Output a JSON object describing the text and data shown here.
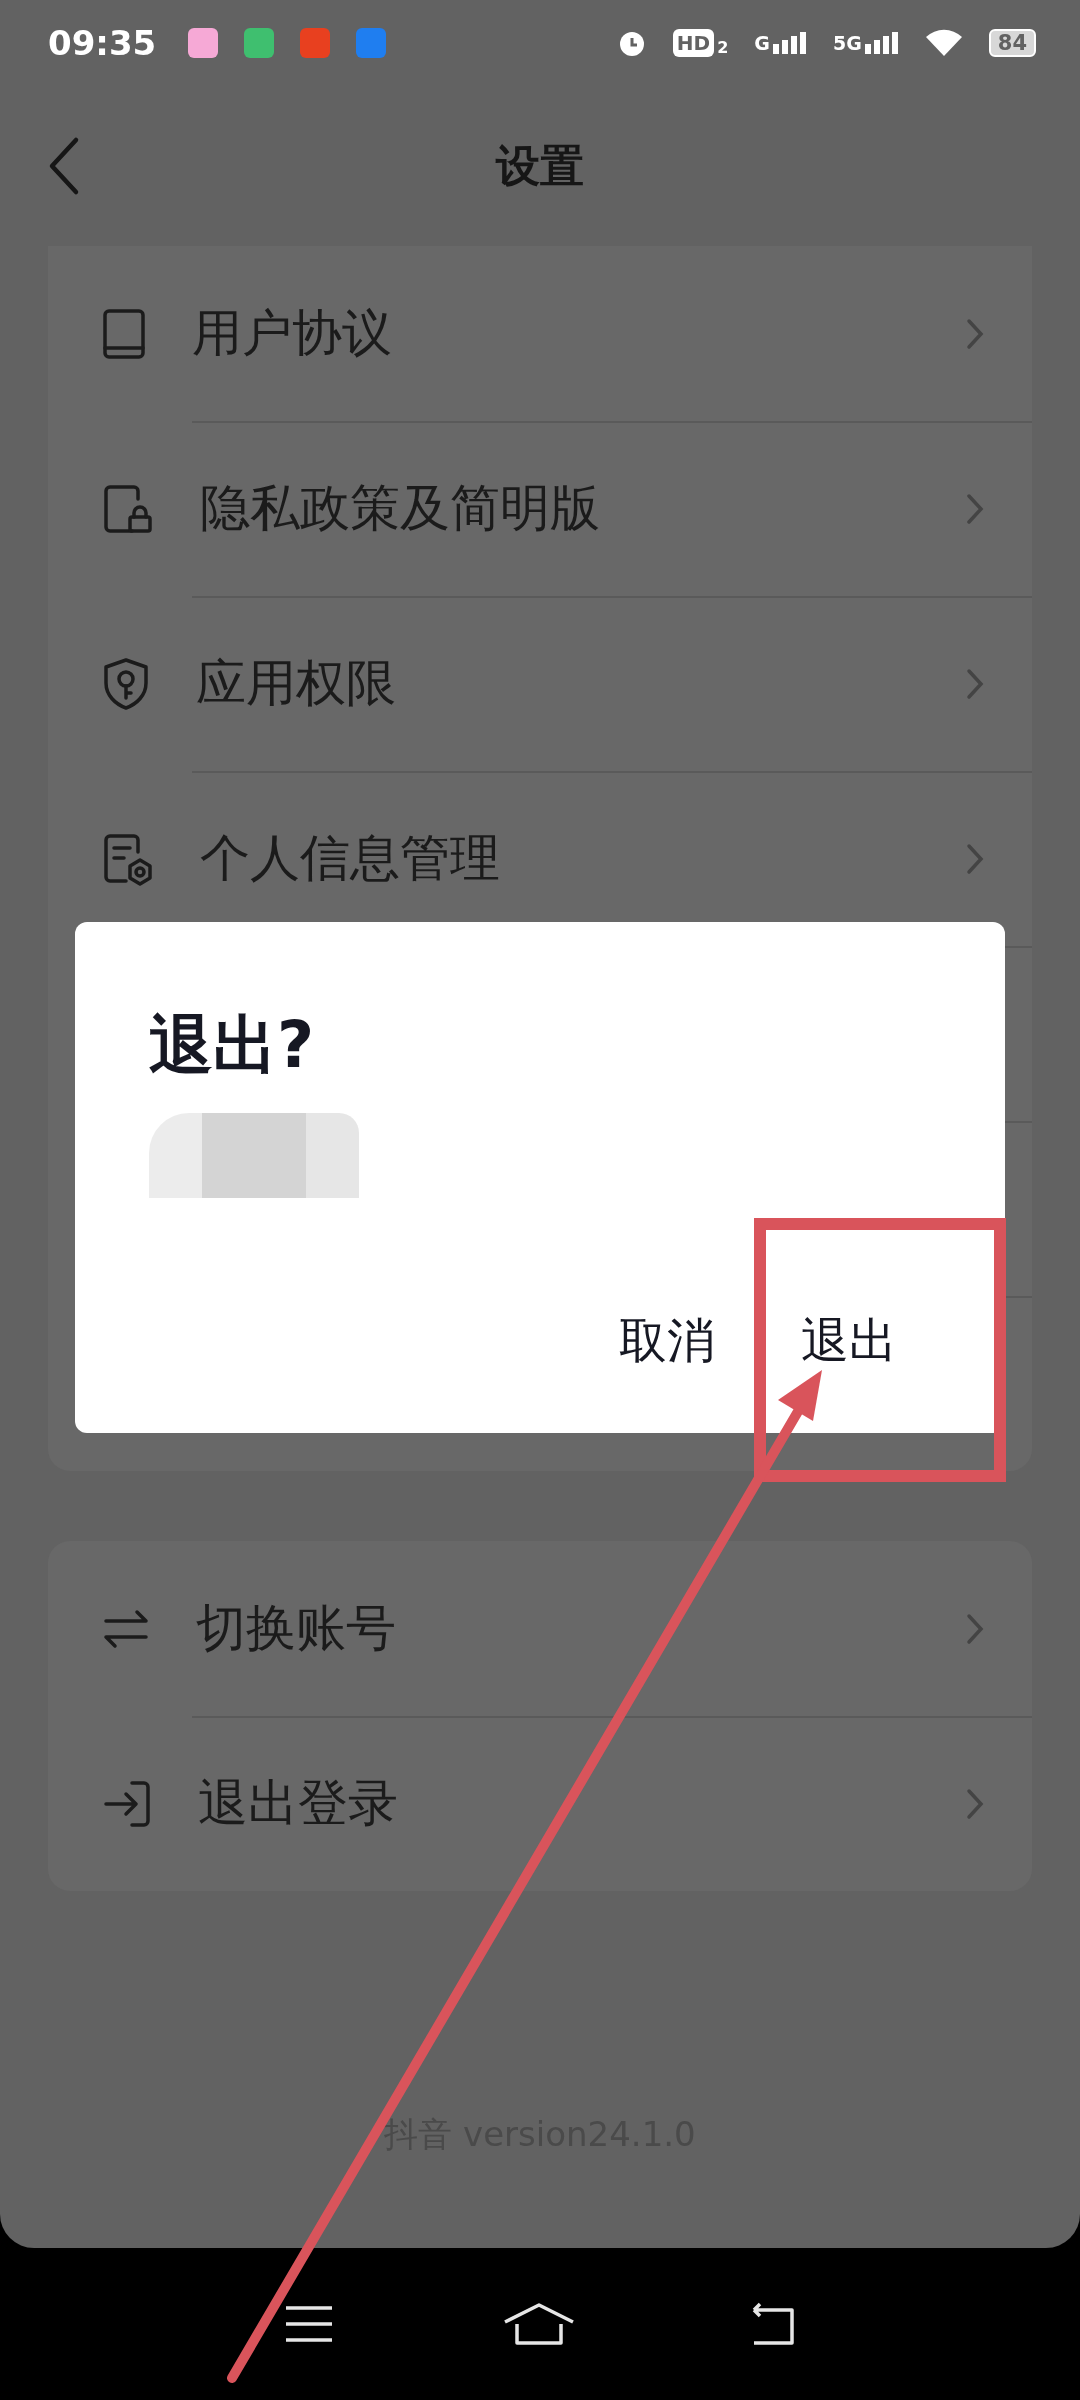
{
  "status_bar": {
    "time": "09:35",
    "hd": "HD",
    "hd_sub": "2",
    "network": [
      {
        "label": "G"
      },
      {
        "label": "5G"
      }
    ],
    "battery": "84"
  },
  "header": {
    "title": "设置"
  },
  "sections": [
    {
      "items": [
        {
          "label": "用户协议"
        },
        {
          "label": "隐私政策及简明版"
        },
        {
          "label": "应用权限"
        },
        {
          "label": "个人信息管理"
        }
      ]
    },
    {
      "items": [
        {
          "label": "切换账号"
        },
        {
          "label": "退出登录"
        }
      ]
    }
  ],
  "dialog": {
    "title": "退出?",
    "buttons": [
      {
        "label": "取消"
      },
      {
        "label": "退出"
      }
    ]
  },
  "footer": {
    "version": "抖音 version24.1.0"
  }
}
